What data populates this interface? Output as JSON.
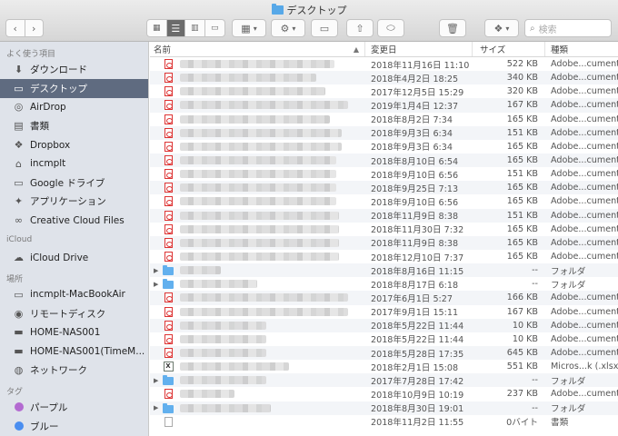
{
  "window": {
    "title": "デスクトップ"
  },
  "toolbar": {
    "search_placeholder": "検索"
  },
  "sidebar": {
    "sections": [
      {
        "title": "よく使う項目",
        "items": [
          {
            "label": "ダウンロード",
            "icon": "download-icon",
            "glyph": "⬇",
            "selected": false
          },
          {
            "label": "デスクトップ",
            "icon": "desktop-icon",
            "glyph": "▭",
            "selected": true
          },
          {
            "label": "AirDrop",
            "icon": "airdrop-icon",
            "glyph": "◎",
            "selected": false
          },
          {
            "label": "書類",
            "icon": "documents-icon",
            "glyph": "▤",
            "selected": false
          },
          {
            "label": "Dropbox",
            "icon": "dropbox-icon",
            "glyph": "❖",
            "selected": false
          },
          {
            "label": "incmplt",
            "icon": "home-icon",
            "glyph": "⌂",
            "selected": false
          },
          {
            "label": "Google ドライブ",
            "icon": "folder-icon",
            "glyph": "▭",
            "selected": false
          },
          {
            "label": "アプリケーション",
            "icon": "applications-icon",
            "glyph": "✦",
            "selected": false
          },
          {
            "label": "Creative Cloud Files",
            "icon": "creative-cloud-icon",
            "glyph": "∞",
            "selected": false
          }
        ]
      },
      {
        "title": "iCloud",
        "items": [
          {
            "label": "iCloud Drive",
            "icon": "cloud-icon",
            "glyph": "☁",
            "selected": false
          }
        ]
      },
      {
        "title": "場所",
        "items": [
          {
            "label": "incmplt-MacBookAir",
            "icon": "laptop-icon",
            "glyph": "▭",
            "selected": false
          },
          {
            "label": "リモートディスク",
            "icon": "remote-disc-icon",
            "glyph": "◉",
            "selected": false
          },
          {
            "label": "HOME-NAS001",
            "icon": "server-icon",
            "glyph": "▬",
            "selected": false
          },
          {
            "label": "HOME-NAS001(TimeM...",
            "icon": "server-icon",
            "glyph": "▬",
            "selected": false
          },
          {
            "label": "ネットワーク",
            "icon": "network-icon",
            "glyph": "◍",
            "selected": false
          }
        ]
      },
      {
        "title": "タグ",
        "items": [
          {
            "label": "パープル",
            "icon": "tag-purple-icon",
            "color": "#b36ad1",
            "selected": false
          },
          {
            "label": "ブルー",
            "icon": "tag-blue-icon",
            "color": "#4a8ef0",
            "selected": false
          }
        ]
      }
    ]
  },
  "columns": {
    "name": "名前",
    "date": "変更日",
    "size": "サイズ",
    "kind": "種類"
  },
  "files": [
    {
      "type": "pdf",
      "w": 170,
      "date": "2018年11月16日 11:10",
      "size": "522 KB",
      "kind": "Adobe...cument"
    },
    {
      "type": "pdf",
      "w": 150,
      "date": "2018年4月2日 18:25",
      "size": "340 KB",
      "kind": "Adobe...cument"
    },
    {
      "type": "pdf",
      "w": 160,
      "date": "2017年12月5日 15:29",
      "size": "320 KB",
      "kind": "Adobe...cument"
    },
    {
      "type": "pdf",
      "w": 185,
      "date": "2019年1月4日 12:37",
      "size": "167 KB",
      "kind": "Adobe...cument"
    },
    {
      "type": "pdf",
      "w": 165,
      "date": "2018年8月2日 7:34",
      "size": "165 KB",
      "kind": "Adobe...cument"
    },
    {
      "type": "pdf",
      "w": 178,
      "date": "2018年9月3日 6:34",
      "size": "151 KB",
      "kind": "Adobe...cument"
    },
    {
      "type": "pdf",
      "w": 178,
      "date": "2018年9月3日 6:34",
      "size": "165 KB",
      "kind": "Adobe...cument"
    },
    {
      "type": "pdf",
      "w": 172,
      "date": "2018年8月10日 6:54",
      "size": "165 KB",
      "kind": "Adobe...cument"
    },
    {
      "type": "pdf",
      "w": 172,
      "date": "2018年9月10日 6:56",
      "size": "151 KB",
      "kind": "Adobe...cument"
    },
    {
      "type": "pdf",
      "w": 172,
      "date": "2018年9月25日 7:13",
      "size": "165 KB",
      "kind": "Adobe...cument"
    },
    {
      "type": "pdf",
      "w": 172,
      "date": "2018年9月10日 6:56",
      "size": "165 KB",
      "kind": "Adobe...cument"
    },
    {
      "type": "pdf",
      "w": 175,
      "date": "2018年11月9日 8:38",
      "size": "151 KB",
      "kind": "Adobe...cument"
    },
    {
      "type": "pdf",
      "w": 175,
      "date": "2018年11月30日 7:32",
      "size": "165 KB",
      "kind": "Adobe...cument"
    },
    {
      "type": "pdf",
      "w": 175,
      "date": "2018年11月9日 8:38",
      "size": "165 KB",
      "kind": "Adobe...cument"
    },
    {
      "type": "pdf",
      "w": 175,
      "date": "2018年12月10日 7:37",
      "size": "165 KB",
      "kind": "Adobe...cument"
    },
    {
      "type": "folder",
      "w": 45,
      "date": "2018年8月16日 11:15",
      "size": "--",
      "kind": "フォルダ"
    },
    {
      "type": "folder",
      "w": 85,
      "date": "2018年8月17日 6:18",
      "size": "--",
      "kind": "フォルダ"
    },
    {
      "type": "pdf",
      "w": 185,
      "date": "2017年6月1日 5:27",
      "size": "166 KB",
      "kind": "Adobe...cument"
    },
    {
      "type": "pdf",
      "w": 185,
      "date": "2017年9月1日 15:11",
      "size": "167 KB",
      "kind": "Adobe...cument"
    },
    {
      "type": "pdf",
      "w": 95,
      "date": "2018年5月22日 11:44",
      "size": "10 KB",
      "kind": "Adobe...cument"
    },
    {
      "type": "pdf",
      "w": 95,
      "date": "2018年5月22日 11:44",
      "size": "10 KB",
      "kind": "Adobe...cument"
    },
    {
      "type": "pdf",
      "w": 95,
      "date": "2018年5月28日 17:35",
      "size": "645 KB",
      "kind": "Adobe...cument"
    },
    {
      "type": "xlsx",
      "w": 120,
      "date": "2018年2月1日 15:08",
      "size": "551 KB",
      "kind": "Micros...k (.xlsx)"
    },
    {
      "type": "folder",
      "w": 95,
      "date": "2017年7月28日 17:42",
      "size": "--",
      "kind": "フォルダ"
    },
    {
      "type": "pdf",
      "w": 60,
      "date": "2018年10月9日 10:19",
      "size": "237 KB",
      "kind": "Adobe...cument"
    },
    {
      "type": "folder",
      "w": 100,
      "date": "2018年8月30日 19:01",
      "size": "--",
      "kind": "フォルダ"
    },
    {
      "type": "doc",
      "w": 0,
      "date": "2018年11月2日 11:55",
      "size": "0バイト",
      "kind": "書類"
    }
  ]
}
